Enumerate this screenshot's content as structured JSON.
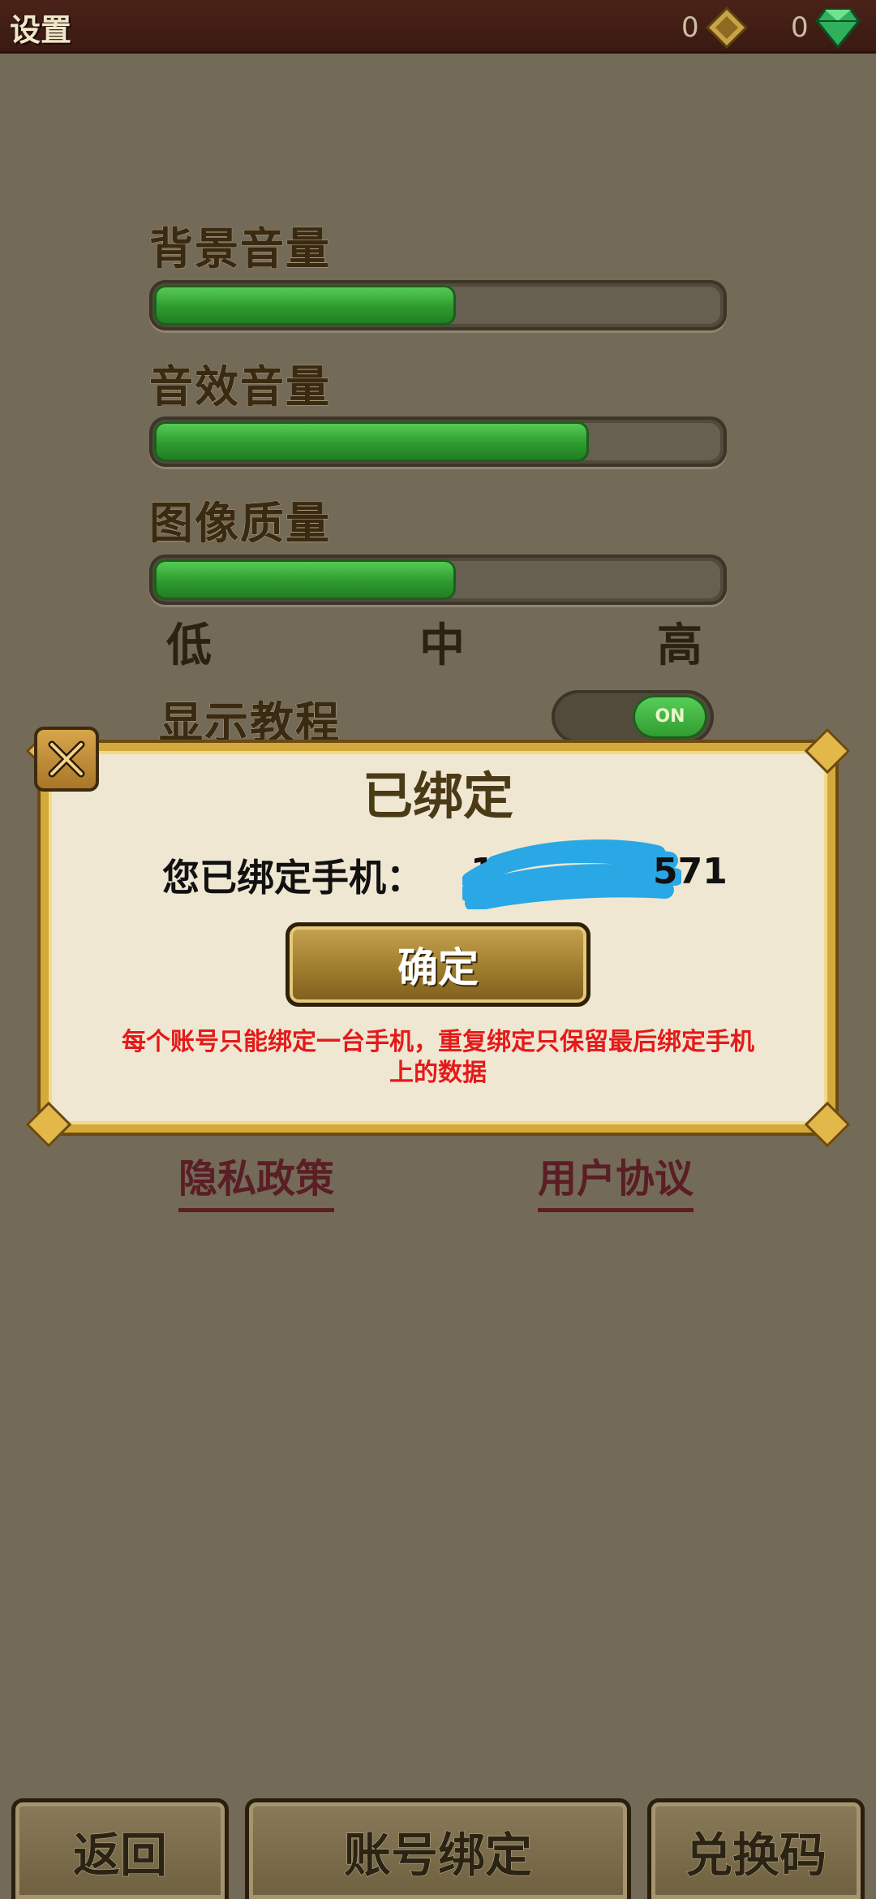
{
  "header": {
    "title": "设置",
    "currency_gold": "0",
    "currency_gem": "0"
  },
  "settings": {
    "bg_volume_label": "背景音量",
    "bg_volume_level": 0.54,
    "sfx_volume_label": "音效音量",
    "sfx_volume_level": 0.77,
    "quality_label": "图像质量",
    "quality_level": 0.54,
    "quality_low": "低",
    "quality_mid": "中",
    "quality_high": "高",
    "tutorial_label": "显示教程",
    "tutorial_toggle": "ON"
  },
  "dialog": {
    "title": "已绑定",
    "bound_prefix": "您已绑定手机：",
    "phone_visible_start": "1",
    "phone_visible_end": "571",
    "confirm_label": "确定",
    "warning": "每个账号只能绑定一台手机，重复绑定只保留最后绑定手机上的数据"
  },
  "links": {
    "privacy": "隐私政策",
    "agreement": "用户协议"
  },
  "bottom": {
    "back": "返回",
    "bind": "账号绑定",
    "redeem": "兑换码"
  },
  "colors": {
    "background": "#736a58",
    "slider_fill": "#2e9a2e",
    "warning_text": "#e41a1a",
    "link_text": "#5a1e24"
  }
}
